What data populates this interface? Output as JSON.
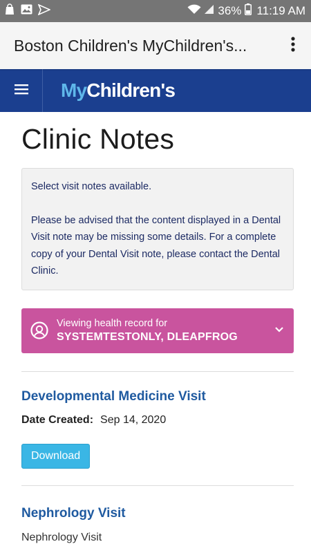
{
  "status_bar": {
    "battery": "36%",
    "time": "11:19 AM"
  },
  "app_bar": {
    "title": "Boston Children's MyChildren's..."
  },
  "header": {
    "logo_my": "My",
    "logo_children": "Children's"
  },
  "page": {
    "title": "Clinic Notes",
    "notice_line1": "Select visit notes available.",
    "notice_line2": "Please be advised that the content displayed in a Dental Visit note may be missing some details. For a complete copy of your Dental Visit note, please contact the Dental Clinic."
  },
  "viewing": {
    "label": "Viewing health record for",
    "name": "SYSTEMTESTONLY, DLEAPFROG",
    "color": "#c9549e"
  },
  "visits": [
    {
      "title": "Developmental Medicine Visit",
      "date_label": "Date Created:",
      "date_value": "Sep 14, 2020",
      "button_label": "Download"
    },
    {
      "title": "Nephrology Visit",
      "subtitle": "Nephrology Visit"
    }
  ],
  "colors": {
    "header_bg": "#1b3f8f",
    "link_blue": "#1f5aa0",
    "button_bg": "#3ab6e5"
  }
}
